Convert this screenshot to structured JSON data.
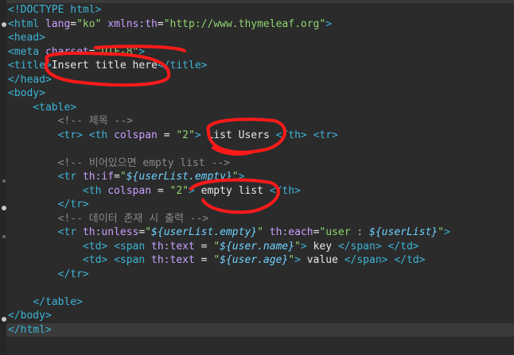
{
  "editor": {
    "language": "html",
    "lines": [
      {
        "tokens": [
          {
            "c": "tag",
            "t": "<!DOCTYPE html>"
          }
        ]
      },
      {
        "tokens": [
          {
            "c": "tag",
            "t": "<html "
          },
          {
            "c": "kw",
            "t": "lang"
          },
          {
            "c": "txt",
            "t": "="
          },
          {
            "c": "str",
            "t": "\"ko\""
          },
          {
            "c": "txt",
            "t": " "
          },
          {
            "c": "kw",
            "t": "xmlns:th"
          },
          {
            "c": "txt",
            "t": "="
          },
          {
            "c": "str",
            "t": "\"http://www.thymeleaf.org\""
          },
          {
            "c": "tag",
            "t": ">"
          }
        ]
      },
      {
        "tokens": [
          {
            "c": "tag",
            "t": "<head>"
          }
        ]
      },
      {
        "tokens": [
          {
            "c": "tag",
            "t": "<meta "
          },
          {
            "c": "kw",
            "t": "charset"
          },
          {
            "c": "txt",
            "t": "="
          },
          {
            "c": "str",
            "t": "\"UTF-8\""
          },
          {
            "c": "tag",
            "t": ">"
          }
        ]
      },
      {
        "tokens": [
          {
            "c": "tag",
            "t": "<title>"
          },
          {
            "c": "txt",
            "t": "Insert title here"
          },
          {
            "c": "tag",
            "t": "</title>"
          }
        ]
      },
      {
        "tokens": [
          {
            "c": "tag",
            "t": "</head>"
          }
        ]
      },
      {
        "tokens": [
          {
            "c": "tag",
            "t": "<body>"
          }
        ]
      },
      {
        "tokens": [
          {
            "c": "txt",
            "t": "    "
          },
          {
            "c": "tag",
            "t": "<table>"
          }
        ]
      },
      {
        "tokens": [
          {
            "c": "txt",
            "t": "        "
          },
          {
            "c": "com",
            "t": "<!-- 제목 -->"
          }
        ]
      },
      {
        "tokens": [
          {
            "c": "txt",
            "t": "        "
          },
          {
            "c": "tag",
            "t": "<tr>"
          },
          {
            "c": "txt",
            "t": " "
          },
          {
            "c": "tag",
            "t": "<th "
          },
          {
            "c": "kw",
            "t": "colspan"
          },
          {
            "c": "txt",
            "t": " = "
          },
          {
            "c": "str",
            "t": "\"2\""
          },
          {
            "c": "tag",
            "t": ">"
          },
          {
            "c": "txt",
            "t": " List Users "
          },
          {
            "c": "tag",
            "t": "</th>"
          },
          {
            "c": "txt",
            "t": " "
          },
          {
            "c": "tag",
            "t": "<tr>"
          }
        ]
      },
      {
        "tokens": []
      },
      {
        "tokens": [
          {
            "c": "txt",
            "t": "        "
          },
          {
            "c": "com",
            "t": "<!-- 비어있으면 empty list -->"
          }
        ]
      },
      {
        "tokens": [
          {
            "c": "txt",
            "t": "        "
          },
          {
            "c": "tag",
            "t": "<tr "
          },
          {
            "c": "kw",
            "t": "th:if"
          },
          {
            "c": "txt",
            "t": "="
          },
          {
            "c": "str",
            "t": "\""
          },
          {
            "c": "expr",
            "t": "${userList.empty}"
          },
          {
            "c": "str",
            "t": "\""
          },
          {
            "c": "tag",
            "t": ">"
          }
        ]
      },
      {
        "tokens": [
          {
            "c": "txt",
            "t": "            "
          },
          {
            "c": "tag",
            "t": "<th "
          },
          {
            "c": "kw",
            "t": "colspan"
          },
          {
            "c": "txt",
            "t": " = "
          },
          {
            "c": "str",
            "t": "\"2\""
          },
          {
            "c": "tag",
            "t": ">"
          },
          {
            "c": "txt",
            "t": " empty list "
          },
          {
            "c": "tag",
            "t": "</th>"
          }
        ]
      },
      {
        "tokens": [
          {
            "c": "txt",
            "t": "        "
          },
          {
            "c": "tag",
            "t": "</tr>"
          }
        ]
      },
      {
        "tokens": [
          {
            "c": "txt",
            "t": "        "
          },
          {
            "c": "com",
            "t": "<!-- 데이터 존재 시 출력 -->"
          }
        ]
      },
      {
        "tokens": [
          {
            "c": "txt",
            "t": "        "
          },
          {
            "c": "tag",
            "t": "<tr "
          },
          {
            "c": "kw",
            "t": "th:unless"
          },
          {
            "c": "txt",
            "t": "="
          },
          {
            "c": "str",
            "t": "\""
          },
          {
            "c": "expr",
            "t": "${userList.empty}"
          },
          {
            "c": "str",
            "t": "\""
          },
          {
            "c": "txt",
            "t": " "
          },
          {
            "c": "kw",
            "t": "th:each"
          },
          {
            "c": "txt",
            "t": "="
          },
          {
            "c": "str",
            "t": "\"user : "
          },
          {
            "c": "expr",
            "t": "${userList}"
          },
          {
            "c": "str",
            "t": "\""
          },
          {
            "c": "tag",
            "t": ">"
          }
        ]
      },
      {
        "tokens": [
          {
            "c": "txt",
            "t": "            "
          },
          {
            "c": "tag",
            "t": "<td>"
          },
          {
            "c": "txt",
            "t": " "
          },
          {
            "c": "tag",
            "t": "<span "
          },
          {
            "c": "kw",
            "t": "th:text"
          },
          {
            "c": "txt",
            "t": " = "
          },
          {
            "c": "str",
            "t": "\""
          },
          {
            "c": "expr",
            "t": "${user.name}"
          },
          {
            "c": "str",
            "t": "\""
          },
          {
            "c": "tag",
            "t": ">"
          },
          {
            "c": "txt",
            "t": " key "
          },
          {
            "c": "tag",
            "t": "</span>"
          },
          {
            "c": "txt",
            "t": " "
          },
          {
            "c": "tag",
            "t": "</td>"
          }
        ]
      },
      {
        "tokens": [
          {
            "c": "txt",
            "t": "            "
          },
          {
            "c": "tag",
            "t": "<td>"
          },
          {
            "c": "txt",
            "t": " "
          },
          {
            "c": "tag",
            "t": "<span "
          },
          {
            "c": "kw",
            "t": "th:text"
          },
          {
            "c": "txt",
            "t": " = "
          },
          {
            "c": "str",
            "t": "\""
          },
          {
            "c": "expr",
            "t": "${user.age}"
          },
          {
            "c": "str",
            "t": "\""
          },
          {
            "c": "tag",
            "t": ">"
          },
          {
            "c": "txt",
            "t": " value "
          },
          {
            "c": "tag",
            "t": "</span>"
          },
          {
            "c": "txt",
            "t": " "
          },
          {
            "c": "tag",
            "t": "</td>"
          }
        ]
      },
      {
        "tokens": [
          {
            "c": "txt",
            "t": "        "
          },
          {
            "c": "tag",
            "t": "</tr>"
          }
        ]
      },
      {
        "tokens": []
      },
      {
        "tokens": [
          {
            "c": "txt",
            "t": "    "
          },
          {
            "c": "tag",
            "t": "</table>"
          }
        ]
      },
      {
        "tokens": [
          {
            "c": "tag",
            "t": "</body>"
          }
        ]
      },
      {
        "tokens": [
          {
            "c": "tag",
            "t": "</html>"
          }
        ]
      }
    ]
  },
  "colors": {
    "background": "#2b2b2b",
    "tag": "#3cb4d6",
    "attribute": "#c6a0ff",
    "string": "#8fd46e",
    "expression": "#6fd2ff",
    "comment": "#8a8a8a",
    "annotation": "#ff1a1a"
  }
}
